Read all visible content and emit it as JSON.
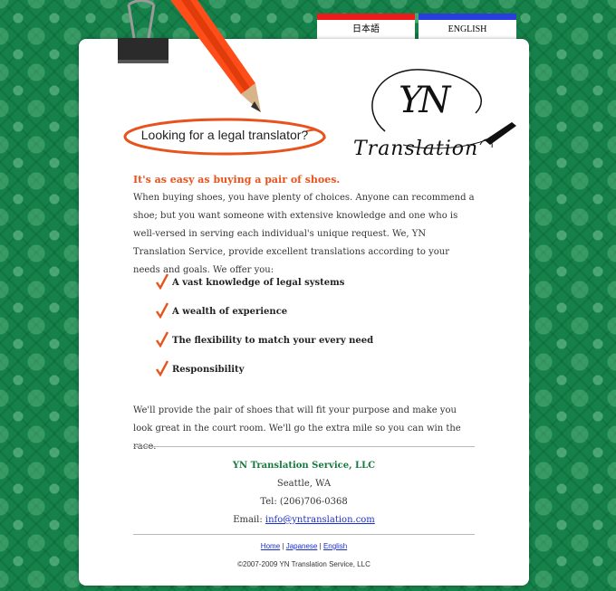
{
  "tabs": {
    "japanese": "日本語",
    "english": "ENGLISH"
  },
  "speech_bubble": "Looking for a legal translator?",
  "logo": {
    "mark": "YN",
    "wordmark": "Translation"
  },
  "headline": "It's as easy as buying a pair of shoes.",
  "intro": "When buying shoes, you have plenty of choices. Anyone can recommend a shoe; but you want someone with extensive knowledge and one who is well-versed in serving each individual's unique request. We, YN Translation Service, provide excellent translations according to your needs and goals. We offer you:",
  "offers": [
    "A vast knowledge of legal systems",
    "A wealth of experience",
    "The flexibility to match your every need",
    "Responsibility"
  ],
  "closing": "We'll provide the pair of shoes that will fit your purpose and make you look great in the court room. We'll go the extra mile so you can win the race.",
  "contact": {
    "company": "YN Translation Service, LLC",
    "location": "Seattle, WA",
    "tel": "Tel: (206)706-0368",
    "email_label": "Email:",
    "email": "info@yntranslation.com"
  },
  "footer_nav": {
    "home": "Home",
    "japanese": "Japanese",
    "english": "English",
    "separator": "|"
  },
  "copyright": "©2007-2009 YN Translation Service, LLC",
  "colors": {
    "background": "#16814a",
    "accent_orange": "#e8531d",
    "company_green": "#167a3c",
    "link": "#1a2fd0",
    "tab_red": "#ee1b1b",
    "tab_blue": "#2a3ee0"
  }
}
